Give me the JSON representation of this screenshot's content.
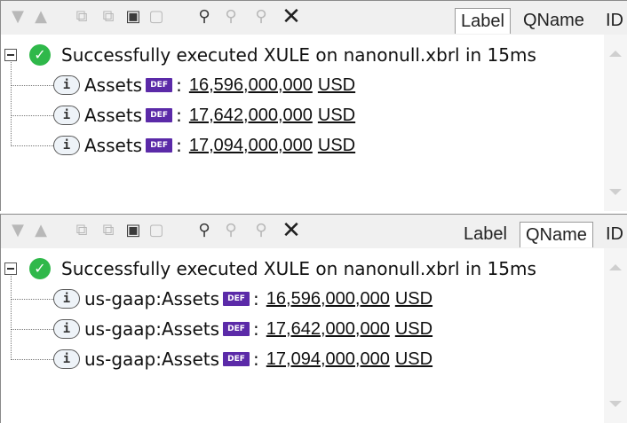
{
  "panels": [
    {
      "tabs": [
        "Label",
        "QName",
        "ID"
      ],
      "selected_tab": "Label",
      "root_message": "Successfully executed XULE on nanonull.xbrl in 15ms",
      "items": [
        {
          "name": "Assets",
          "badge": "DEF",
          "separator": ":",
          "value": "16,596,000,000",
          "unit": "USD"
        },
        {
          "name": "Assets",
          "badge": "DEF",
          "separator": ":",
          "value": "17,642,000,000",
          "unit": "USD"
        },
        {
          "name": "Assets",
          "badge": "DEF",
          "separator": ":",
          "value": "17,094,000,000",
          "unit": "USD"
        }
      ]
    },
    {
      "tabs": [
        "Label",
        "QName",
        "ID"
      ],
      "selected_tab": "QName",
      "root_message": "Successfully executed XULE on nanonull.xbrl in 15ms",
      "items": [
        {
          "name": "us-gaap:Assets",
          "badge": "DEF",
          "separator": ":",
          "value": "16,596,000,000",
          "unit": "USD"
        },
        {
          "name": "us-gaap:Assets",
          "badge": "DEF",
          "separator": ":",
          "value": "17,642,000,000",
          "unit": "USD"
        },
        {
          "name": "us-gaap:Assets",
          "badge": "DEF",
          "separator": ":",
          "value": "17,094,000,000",
          "unit": "USD"
        }
      ]
    }
  ],
  "icons": {
    "toolbar": [
      "triangle-down-icon",
      "triangle-up-icon",
      "copy-icon",
      "copy-all-icon",
      "paste-icon",
      "export-icon",
      "find-icon",
      "find-next-icon",
      "find-previous-icon",
      "close-icon"
    ],
    "root": "success-check-icon",
    "item": "info-icon",
    "badge": "definition-badge-icon"
  },
  "colors": {
    "success": "#2fb84a",
    "badge": "#5b2aa8",
    "toolbar_bg": "#f0f0f0"
  }
}
